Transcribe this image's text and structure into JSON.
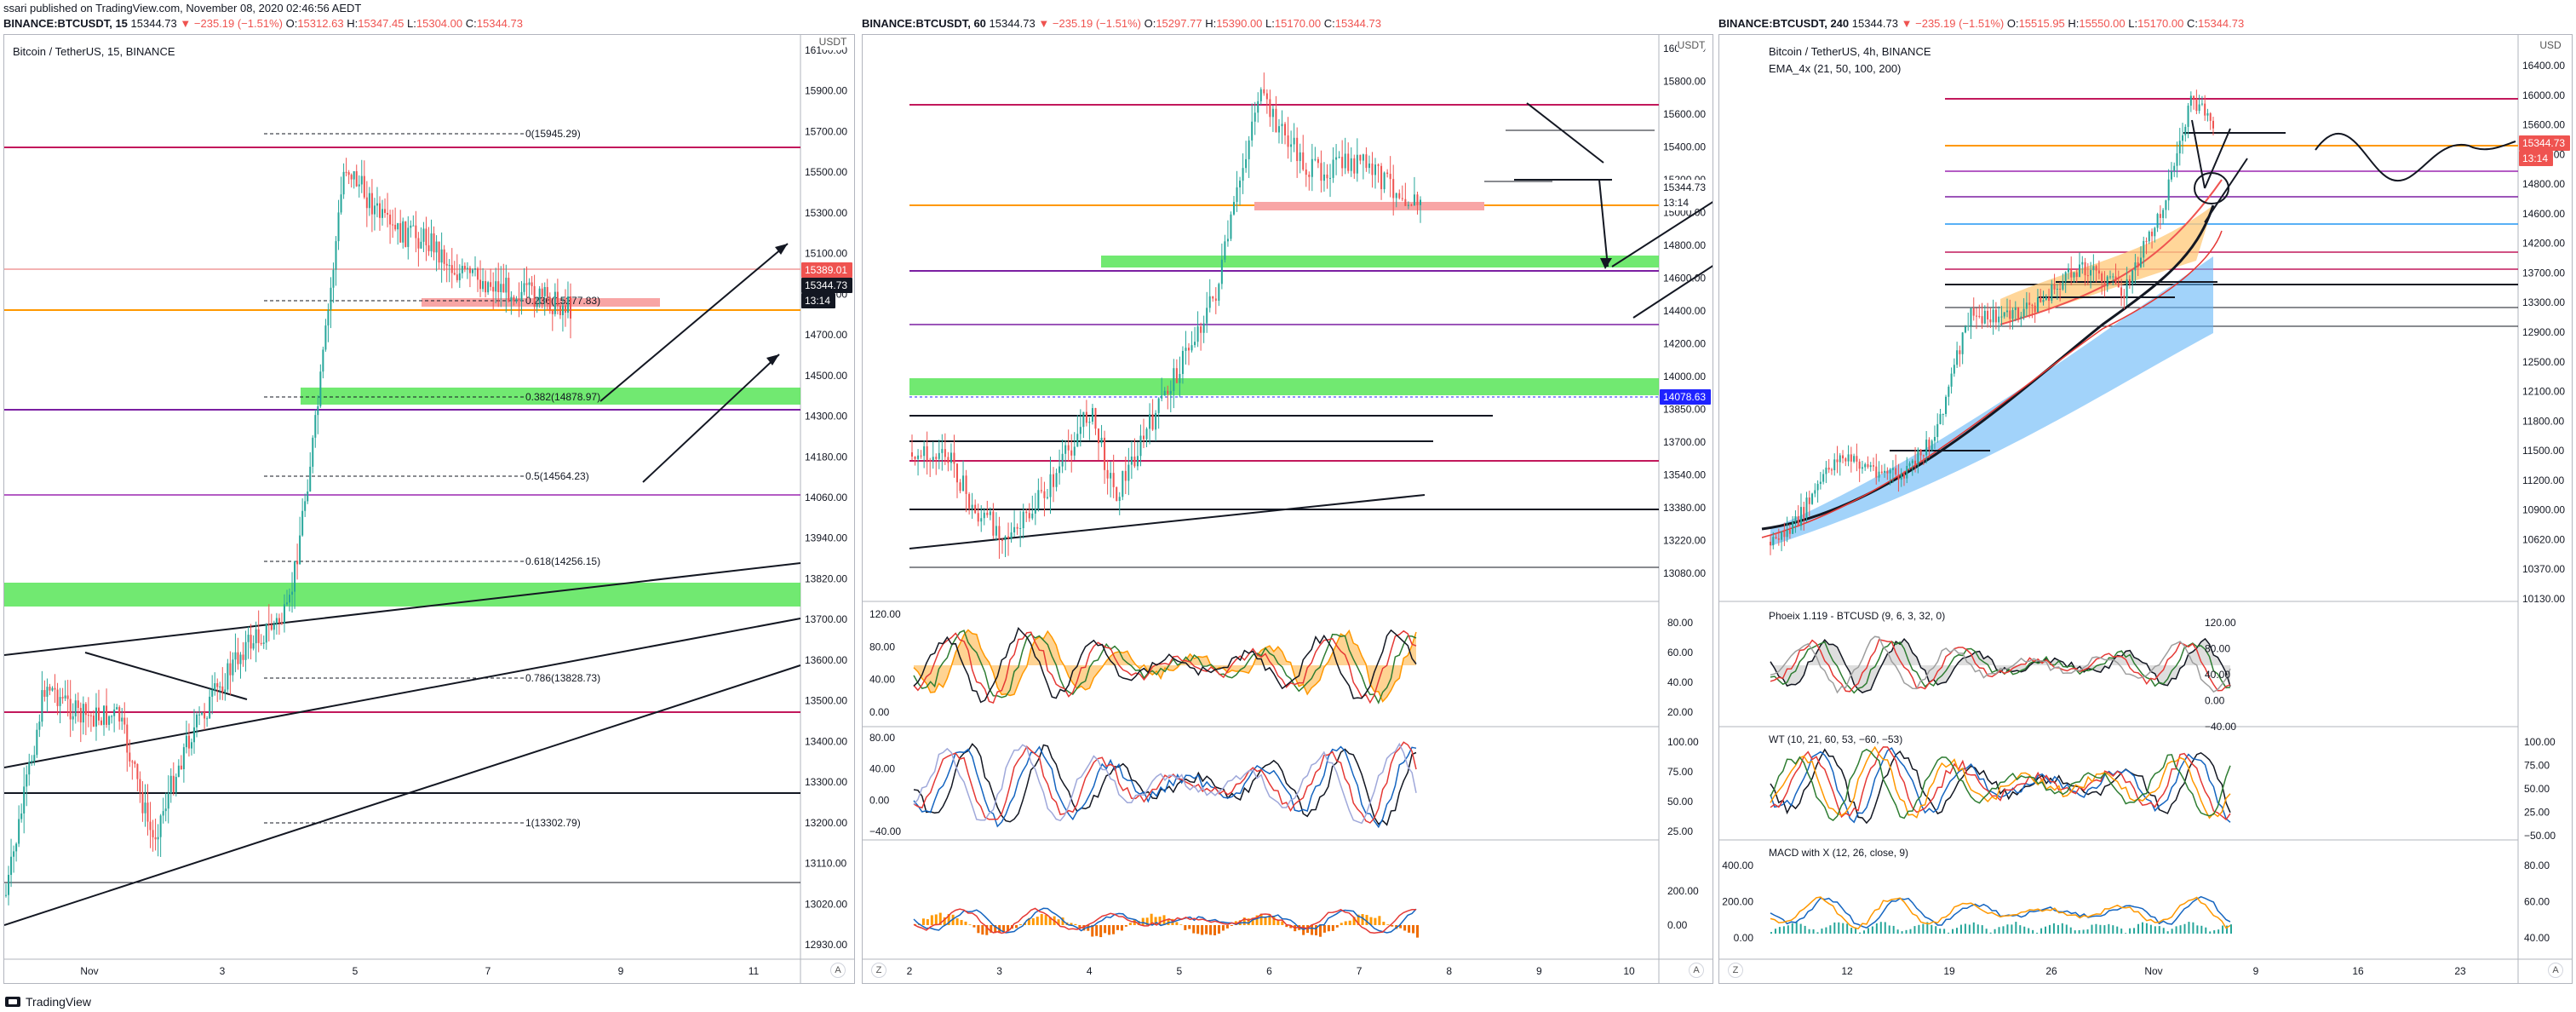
{
  "header": {
    "published": "ssari published on TradingView.com, November 08, 2020 02:46:56 AEDT"
  },
  "brand": {
    "name": "TradingView"
  },
  "colors": {
    "up": "#26a69a",
    "down": "#ef5350",
    "bg": "#ffffff",
    "grid": "#e0e3eb"
  },
  "panels": [
    {
      "header": "BINANCE:BTCUSDT, 15",
      "price": "15344.73",
      "change": "−235.19 (−1.51%)",
      "o": "15312.63",
      "h": "15347.45",
      "l": "15304.00",
      "c": "15344.73",
      "title": "Bitcoin / TetherUS, 15, BINANCE",
      "axis_unit": "USDT",
      "y_ticks": [
        "16100.00",
        "15900.00",
        "15700.00",
        "15500.00",
        "15300.00",
        "15100.00",
        "14900.00",
        "14700.00",
        "14500.00",
        "14300.00",
        "14180.00",
        "14060.00",
        "13940.00",
        "13820.00",
        "13700.00",
        "13600.00",
        "13500.00",
        "13400.00",
        "13300.00",
        "13200.00",
        "13110.00",
        "13020.00",
        "12930.00"
      ],
      "x_ticks": [
        "Nov",
        "3",
        "5",
        "7",
        "9",
        "11"
      ],
      "fib": [
        {
          "label": "0(15945.29)"
        },
        {
          "label": "0.236(15277.83)"
        },
        {
          "label": "0.382(14878.97)"
        },
        {
          "label": "0.5(14564.23)"
        },
        {
          "label": "0.618(14256.15)"
        },
        {
          "label": "0.786(13828.73)"
        },
        {
          "label": "1(13302.79)"
        }
      ],
      "tags": [
        {
          "text": "15389.01",
          "color": "#ef5350"
        },
        {
          "text": "15344.73",
          "color": "#131722"
        },
        {
          "text": "13:14",
          "color": "#131722"
        }
      ]
    },
    {
      "header": "BINANCE:BTCUSDT, 60",
      "price": "15344.73",
      "change": "−235.19 (−1.51%)",
      "o": "15297.77",
      "h": "15390.00",
      "l": "15170.00",
      "c": "15344.73",
      "axis_unit": "USDT",
      "y_ticks": [
        "16000.00",
        "15800.00",
        "15600.00",
        "15400.00",
        "15200.00",
        "15000.00",
        "14800.00",
        "14600.00",
        "14400.00",
        "14200.00",
        "14000.00",
        "13850.00",
        "13700.00",
        "13540.00",
        "13380.00",
        "13220.00",
        "13080.00"
      ],
      "x_ticks": [
        "2",
        "3",
        "4",
        "5",
        "6",
        "7",
        "8",
        "9",
        "10"
      ],
      "ind1_ticks": [
        "120.00",
        "80.00",
        "40.00",
        "0.00"
      ],
      "ind1_right": [
        "80.00",
        "60.00",
        "40.00",
        "20.00"
      ],
      "ind2_ticks": [
        "80.00",
        "40.00",
        "0.00",
        "−40.00"
      ],
      "ind2_right": [
        "100.00",
        "75.00",
        "50.00",
        "25.00"
      ],
      "ind3_right": [
        "200.00",
        "0.00"
      ],
      "tags": [
        {
          "text": "15344.73",
          "color": "#131722"
        },
        {
          "text": "13:14",
          "color": "#131722"
        },
        {
          "text": "14078.63",
          "color": "#1e22ff"
        }
      ]
    },
    {
      "header": "BINANCE:BTCUSDT, 240",
      "price": "15344.73",
      "change": "−235.19 (−1.51%)",
      "o": "15515.95",
      "h": "15550.00",
      "l": "15170.00",
      "c": "15344.73",
      "title": "Bitcoin / TetherUS, 4h, BINANCE",
      "ema": "EMA_4x (21, 50, 100, 200)",
      "axis_unit": "USD",
      "y_ticks": [
        "16400.00",
        "16000.00",
        "15600.00",
        "15200.00",
        "14800.00",
        "14600.00",
        "14200.00",
        "13700.00",
        "13300.00",
        "12900.00",
        "12500.00",
        "12100.00",
        "11800.00",
        "11500.00",
        "11200.00",
        "10900.00",
        "10620.00",
        "10370.00",
        "10130.00"
      ],
      "x_ticks": [
        "12",
        "19",
        "26",
        "Nov",
        "9",
        "16",
        "23"
      ],
      "phoenix": "Phoeix 1.119 - BTCUSD (9, 6, 3, 32, 0)",
      "phoenix_ticks": [
        "120.00",
        "80.00",
        "40.00",
        "0.00",
        "−40.00"
      ],
      "wt": "WT (10, 21, 60, 53, −60, −53)",
      "wt_ticks": [
        "100.00",
        "75.00",
        "50.00",
        "25.00",
        "−50.00"
      ],
      "macd": "MACD with X (12, 26, close, 9)",
      "macd_left": [
        "400.00",
        "200.00",
        "0.00"
      ],
      "macd_right": [
        "80.00",
        "60.00",
        "40.00"
      ],
      "tags": [
        {
          "text": "15344.73",
          "color": "#ef5350"
        },
        {
          "text": "13:14",
          "color": "#ef5350"
        }
      ]
    }
  ]
}
